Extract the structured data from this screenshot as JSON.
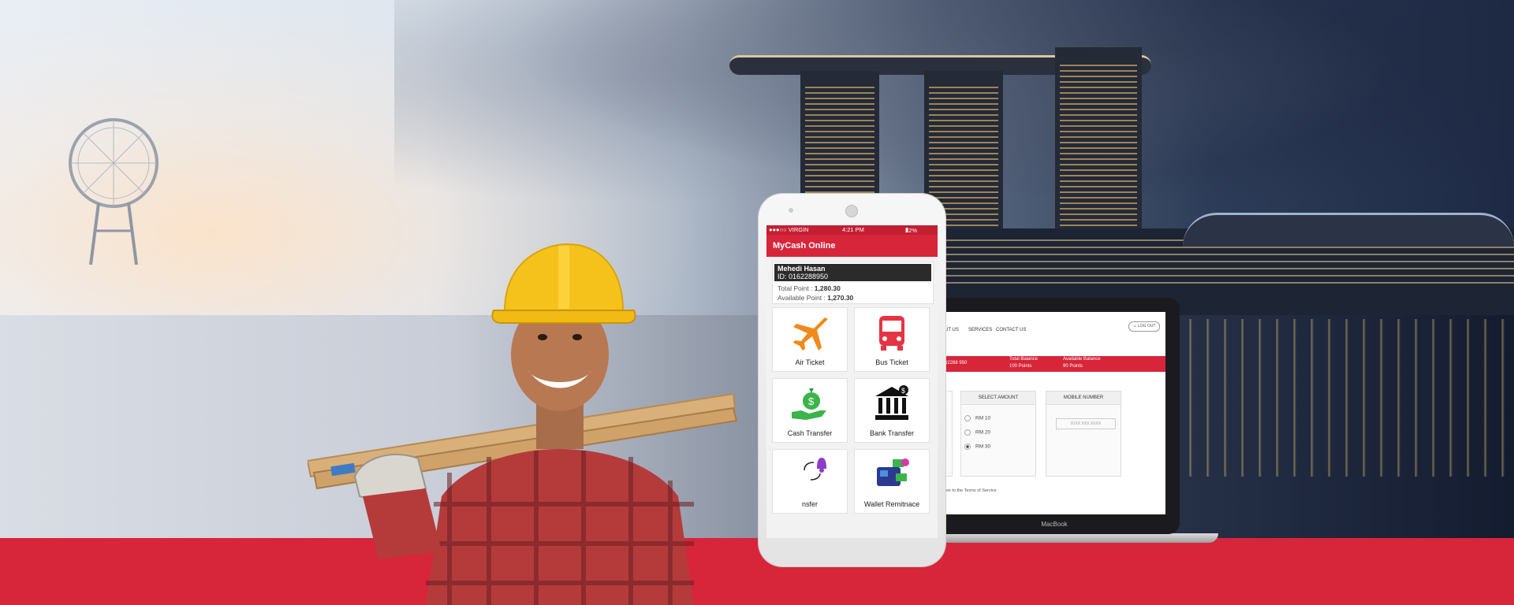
{
  "phone": {
    "status": {
      "carrier": "●●●○○ VIRGIN",
      "time": "4:21 PM",
      "battery": "22%"
    },
    "app_title": "MyCash Online",
    "account": {
      "name": "Mehedi Hasan",
      "id": "ID: 0162288950",
      "total_label": "Total Point :",
      "total_value": "1,280.30",
      "available_label": "Available Point :",
      "available_value": "1,270.30"
    },
    "tiles": [
      {
        "label": "Air Ticket",
        "icon": "airplane-icon"
      },
      {
        "label": "Bus Ticket",
        "icon": "bus-icon"
      },
      {
        "label": "Cash Transfer",
        "icon": "cash-hand-icon"
      },
      {
        "label": "Bank Transfer",
        "icon": "bank-icon"
      },
      {
        "label": "nsfer",
        "icon": "transfer-users-icon"
      },
      {
        "label": "Wallet Remitnace",
        "icon": "wallet-icon"
      }
    ]
  },
  "laptop": {
    "brand": "MacBook",
    "nav": [
      "UT US",
      "SERVICES",
      "CONTACT US"
    ],
    "logout": "LOG OUT",
    "bar": {
      "id": "62288 950",
      "total_label": "Total Balance",
      "total_value": "100 Points",
      "available_label": "Available Balance",
      "available_value": "90 Points"
    },
    "select_amount": {
      "title": "SELECT AMOUNT",
      "options": [
        "RM 10",
        "RM 20",
        "RM 30"
      ]
    },
    "mobile_number": {
      "title": "MOBILE NUMBER",
      "placeholder": "01XX XXX XXXX"
    },
    "terms": "ree to the Terms of Service"
  },
  "colors": {
    "brand_red": "#d7253a"
  }
}
